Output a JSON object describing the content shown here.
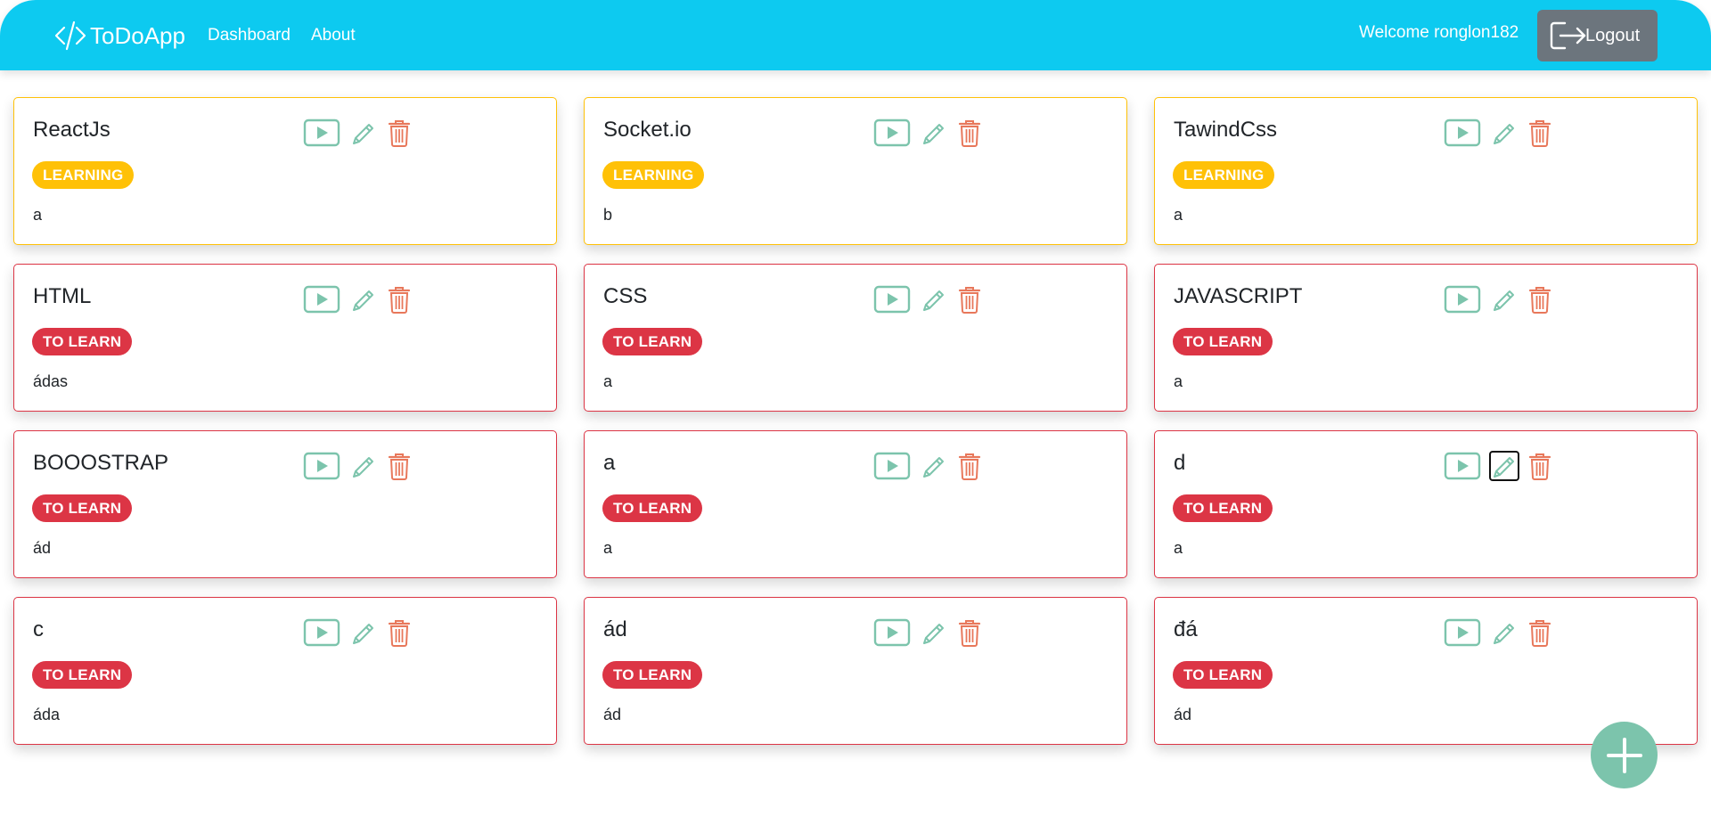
{
  "app": {
    "brand": "ToDoApp",
    "nav": {
      "dashboard": "Dashboard",
      "about": "About"
    },
    "welcome": "Welcome ronglon182",
    "logout_label": "Logout"
  },
  "colors": {
    "navbar": "#0dcaf0",
    "learning": "#ffc107",
    "to_learn": "#dc3545",
    "action_green": "#7cc4ac",
    "delete_orange": "#e8785b",
    "logout_button": "#6c757d"
  },
  "icons": {
    "brand": "code-icon",
    "logout": "logout-icon",
    "play": "play-icon",
    "edit": "pencil-icon",
    "delete": "trash-icon",
    "add": "plus-icon"
  },
  "cards": [
    {
      "title": "ReactJs",
      "status": "LEARNING",
      "description": "a"
    },
    {
      "title": "Socket.io",
      "status": "LEARNING",
      "description": "b"
    },
    {
      "title": "TawindCss",
      "status": "LEARNING",
      "description": "a"
    },
    {
      "title": "HTML",
      "status": "TO LEARN",
      "description": "ádas"
    },
    {
      "title": "CSS",
      "status": "TO LEARN",
      "description": "a"
    },
    {
      "title": "JAVASCRIPT",
      "status": "TO LEARN",
      "description": "a"
    },
    {
      "title": "BOOOSTRAP",
      "status": "TO LEARN",
      "description": "ád"
    },
    {
      "title": "a",
      "status": "TO LEARN",
      "description": "a"
    },
    {
      "title": "d",
      "status": "TO LEARN",
      "description": "a"
    },
    {
      "title": "c",
      "status": "TO LEARN",
      "description": "áda"
    },
    {
      "title": "ád",
      "status": "TO LEARN",
      "description": "ád"
    },
    {
      "title": "đá",
      "status": "TO LEARN",
      "description": "ád"
    }
  ],
  "focused_edit_card": 8
}
